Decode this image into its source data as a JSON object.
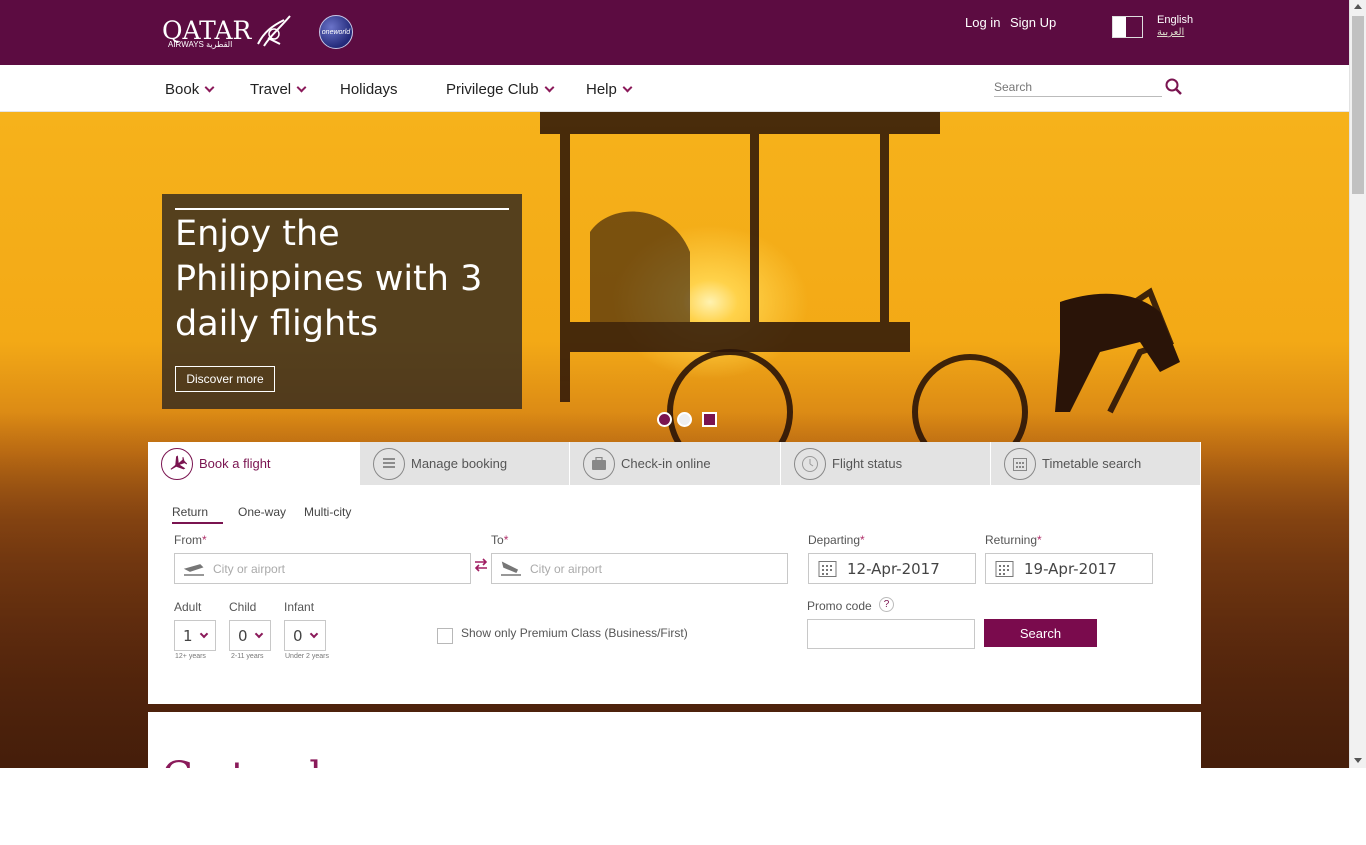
{
  "header": {
    "logo_word": "QATAR",
    "logo_sub": "AIRWAYS القطرية",
    "alliance_badge": "oneworld",
    "login_label": "Log in",
    "signup_label": "Sign Up",
    "language": "English",
    "language_alt": "العربية",
    "brand_color": "#5c0c41"
  },
  "nav": {
    "items": [
      {
        "label": "Book",
        "dropdown": true
      },
      {
        "label": "Travel",
        "dropdown": true
      },
      {
        "label": "Holidays",
        "dropdown": false
      },
      {
        "label": "Privilege Club",
        "dropdown": true
      },
      {
        "label": "Help",
        "dropdown": true
      }
    ],
    "search_placeholder": "Search"
  },
  "hero": {
    "title": "Enjoy the Philippines with 3 daily flights",
    "cta_label": "Discover more",
    "slides": 3,
    "active_slide": 1
  },
  "booking": {
    "tabs": [
      {
        "label": "Book a flight",
        "icon": "plane-icon",
        "active": true
      },
      {
        "label": "Manage booking",
        "icon": "list-icon",
        "active": false
      },
      {
        "label": "Check-in online",
        "icon": "briefcase-icon",
        "active": false
      },
      {
        "label": "Flight status",
        "icon": "clock-icon",
        "active": false
      },
      {
        "label": "Timetable search",
        "icon": "calendar-icon",
        "active": false
      }
    ],
    "trip_types": [
      {
        "label": "Return",
        "active": true
      },
      {
        "label": "One-way",
        "active": false
      },
      {
        "label": "Multi-city",
        "active": false
      }
    ],
    "from": {
      "label": "From",
      "placeholder": "City or airport",
      "value": ""
    },
    "to": {
      "label": "To",
      "placeholder": "City or airport",
      "value": ""
    },
    "departing": {
      "label": "Departing",
      "value": "12-Apr-2017"
    },
    "returning": {
      "label": "Returning",
      "value": "19-Apr-2017"
    },
    "passengers": {
      "adult": {
        "label": "Adult",
        "value": "1",
        "note": "12+ years"
      },
      "child": {
        "label": "Child",
        "value": "0",
        "note": "2-11 years"
      },
      "infant": {
        "label": "Infant",
        "value": "0",
        "note": "Under 2 years"
      }
    },
    "premium_only": {
      "label": "Show only Premium Class (Business/First)",
      "checked": false
    },
    "promo_code": {
      "label": "Promo code",
      "help": "?",
      "value": ""
    },
    "search_label": "Search",
    "required_mark": "*"
  },
  "below_fold_title": "Go to places"
}
